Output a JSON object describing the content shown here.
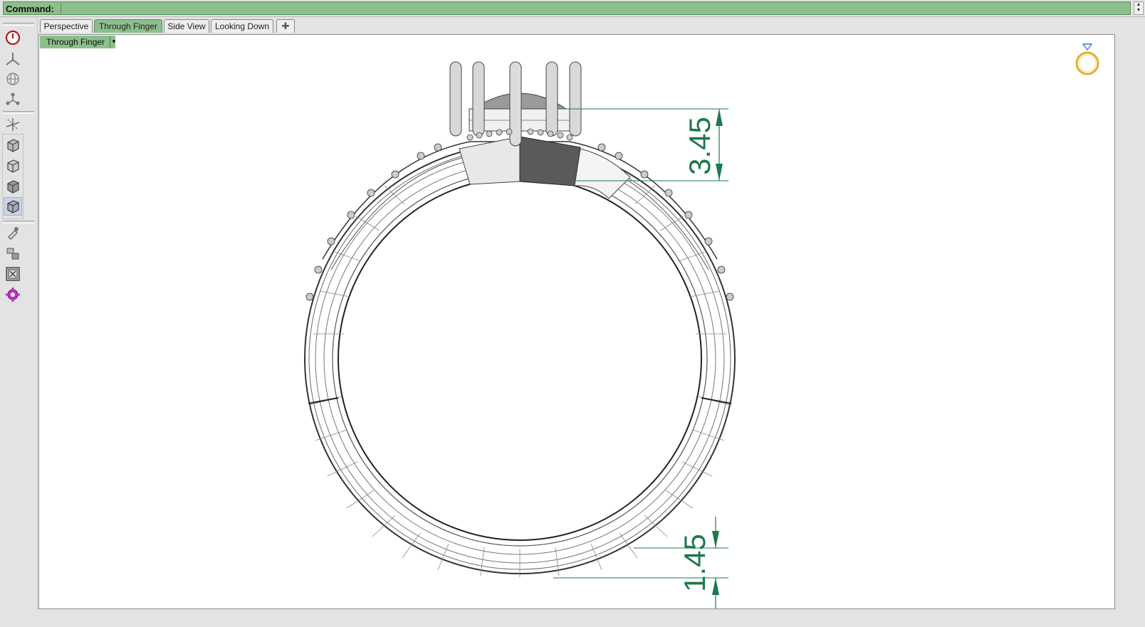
{
  "command_bar": {
    "label": "Command:",
    "value": ""
  },
  "toolbar": {
    "buttons": [
      {
        "icon": "power-icon"
      },
      {
        "icon": "gumball-axis-icon"
      },
      {
        "icon": "sphere-grid-icon"
      },
      {
        "icon": "connect-nodes-icon"
      },
      {
        "icon": "axis-move-icon"
      },
      {
        "icon": "box-view-icon"
      },
      {
        "icon": "box-wire-icon"
      },
      {
        "icon": "box-shaded-icon"
      },
      {
        "icon": "box-rendered-icon"
      },
      {
        "icon": "dropper-icon"
      },
      {
        "icon": "material-tools-icon"
      },
      {
        "icon": "frame-close-icon"
      },
      {
        "icon": "gear-settings-icon"
      }
    ]
  },
  "tabs": [
    {
      "label": "Perspective",
      "active": false
    },
    {
      "label": "Through Finger",
      "active": true
    },
    {
      "label": "Side View",
      "active": false
    },
    {
      "label": "Looking Down",
      "active": false
    }
  ],
  "add_tab_icon": "plus-icon",
  "viewport": {
    "title": "Through Finger",
    "dimensions": {
      "top_thickness": "3.45",
      "bottom_thickness": "1.45"
    },
    "corner_icon": "diamond-ring-icon"
  },
  "colors": {
    "accent_green": "#8cbf8c",
    "dimension_green": "#1a7a4a"
  }
}
